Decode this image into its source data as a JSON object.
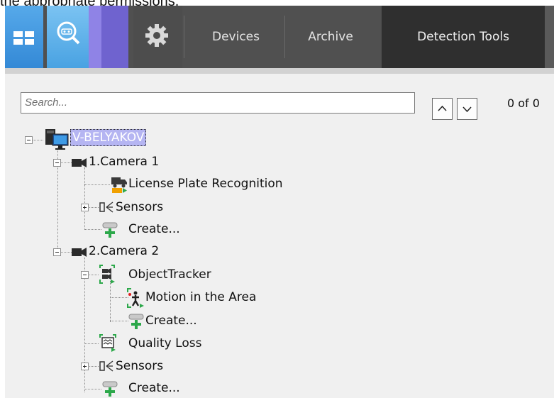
{
  "caption": "the appropriate permissions.",
  "toolbar": {
    "tabs": {
      "devices": "Devices",
      "archive": "Archive",
      "detection_tools": "Detection Tools"
    },
    "active_tab": "Detection Tools",
    "colors": {
      "bar": "#505050",
      "active_tab": "#2f2f2f",
      "grid_button": "#3f95dc",
      "search_button": "#5aafe8",
      "violet": "#6f63cf"
    }
  },
  "search": {
    "placeholder": "Search...",
    "counter": "0 of 0"
  },
  "tree": {
    "server": "V-BELYAKOV",
    "camera1": {
      "label": "1.Camera 1",
      "lpr": "License Plate Recognition",
      "sensors": "Sensors",
      "create": "Create..."
    },
    "camera2": {
      "label": "2.Camera 2",
      "tracker": "ObjectTracker",
      "motion": "Motion in the Area",
      "tracker_create": "Create...",
      "quality_loss": "Quality Loss",
      "sensors": "Sensors",
      "create": "Create..."
    }
  },
  "icons": [
    "layout-grid-icon",
    "archive-search-icon",
    "gear-icon",
    "computer-icon",
    "camera-icon",
    "truck-lpr-icon",
    "sensor-icon",
    "create-add-icon",
    "object-tracker-icon",
    "motion-area-icon",
    "quality-loss-icon",
    "chevron-up-icon",
    "chevron-down-icon"
  ]
}
